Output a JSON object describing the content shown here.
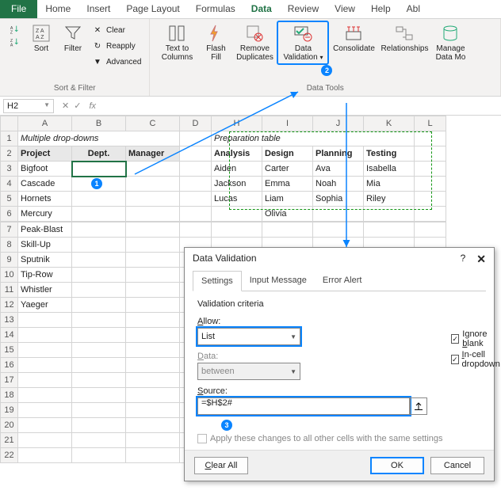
{
  "ribbon": {
    "file": "File",
    "tabs": [
      "Home",
      "Insert",
      "Page Layout",
      "Formulas",
      "Data",
      "Review",
      "View",
      "Help",
      "Abl"
    ],
    "active_tab": "Data",
    "sort_filter": {
      "sort": "Sort",
      "filter": "Filter",
      "clear": "Clear",
      "reapply": "Reapply",
      "advanced": "Advanced",
      "group_label": "Sort & Filter"
    },
    "data_tools": {
      "text_to_columns": "Text to\nColumns",
      "flash_fill": "Flash\nFill",
      "remove_duplicates": "Remove\nDuplicates",
      "data_validation": "Data\nValidation",
      "consolidate": "Consolidate",
      "relationships": "Relationships",
      "manage": "Manage\nData Mo",
      "group_label": "Data Tools"
    }
  },
  "namebox": "H2",
  "formula": "",
  "columns": [
    "A",
    "B",
    "C",
    "D",
    "H",
    "I",
    "J",
    "K",
    "L"
  ],
  "title_left": "Multiple drop-downs",
  "title_right": "Preparation table",
  "headers_left": {
    "a": "Project",
    "b": "Dept.",
    "c": "Manager"
  },
  "headers_right": {
    "h": "Analysis",
    "i": "Design",
    "j": "Planning",
    "k": "Testing"
  },
  "projects": [
    "Bigfoot",
    "Cascade",
    "Hornets",
    "Mercury",
    "Peak-Blast",
    "Skill-Up",
    "Sputnik",
    "Tip-Row",
    "Whistler",
    "Yaeger"
  ],
  "prep": {
    "Analysis": [
      "Aiden",
      "Jackson",
      "Lucas"
    ],
    "Design": [
      "Carter",
      "Emma",
      "Liam",
      "Olivia"
    ],
    "Planning": [
      "Ava",
      "Noah",
      "Sophia"
    ],
    "Testing": [
      "Isabella",
      "Mia",
      "Riley"
    ]
  },
  "dialog": {
    "title": "Data Validation",
    "tabs": [
      "Settings",
      "Input Message",
      "Error Alert"
    ],
    "criteria_label": "Validation criteria",
    "allow_label": "Allow:",
    "allow_value": "List",
    "data_label": "Data:",
    "data_value": "between",
    "source_label": "Source:",
    "source_value": "=$H$2#",
    "ignore_blank": "Ignore blank",
    "incell_dd": "In-cell dropdown",
    "apply_all": "Apply these changes to all other cells with the same settings",
    "clear_all": "Clear All",
    "ok": "OK",
    "cancel": "Cancel"
  },
  "badges": {
    "one": "1",
    "two": "2",
    "three": "3"
  }
}
